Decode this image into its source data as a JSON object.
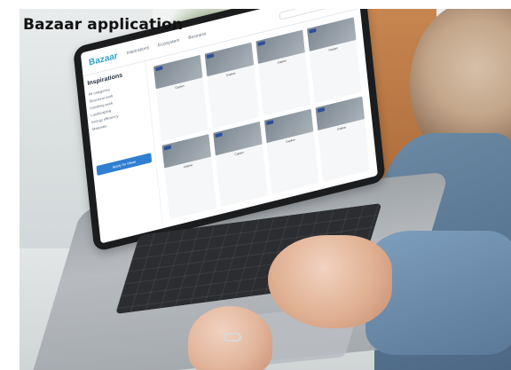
{
  "caption": "Bazaar application",
  "screen": {
    "brand": "Bazaar",
    "nav_links": [
      "Inspirations",
      "Ecosystem",
      "Business"
    ],
    "sidebar_title": "Inspirations",
    "sidebar_items": [
      "All categories",
      "Structural work",
      "Finishing work",
      "Landscaping",
      "Energy efficiency",
      "Materials"
    ],
    "sidebar_button": "Apply for Ideas",
    "tiles": [
      {
        "title": "Caption"
      },
      {
        "title": "Caption"
      },
      {
        "title": "Caption"
      },
      {
        "title": "Caption"
      },
      {
        "title": "Caption"
      },
      {
        "title": "Caption"
      },
      {
        "title": "Caption"
      },
      {
        "title": "Caption"
      }
    ]
  }
}
